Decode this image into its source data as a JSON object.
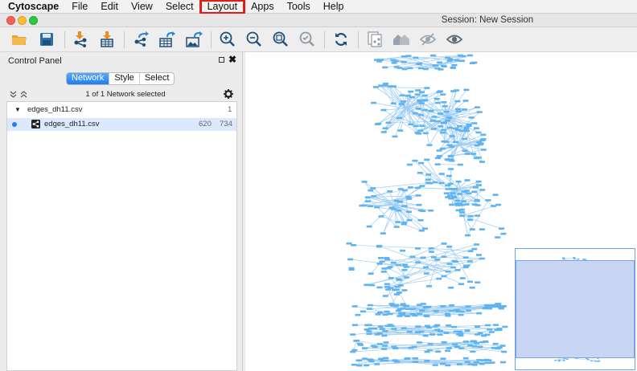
{
  "menubar": {
    "app_name": "Cytoscape",
    "items": [
      "File",
      "Edit",
      "View",
      "Select",
      "Layout",
      "Apps",
      "Tools",
      "Help"
    ],
    "highlighted": "Layout"
  },
  "window": {
    "title": "Session: New Session"
  },
  "toolbar": {
    "buttons": [
      "open-session-icon",
      "save-session-icon",
      "import-network-icon",
      "import-table-icon",
      "export-network-icon",
      "export-table-icon",
      "export-image-icon",
      "zoom-in-icon",
      "zoom-out-icon",
      "zoom-fit-icon",
      "zoom-selected-icon",
      "refresh-icon",
      "new-network-from-selection-icon",
      "home-icon",
      "hide-icon",
      "show-icon"
    ]
  },
  "control_panel": {
    "title": "Control Panel",
    "tabs": [
      "Network",
      "Style",
      "Select"
    ],
    "active_tab": "Network",
    "selection_text": "1 of 1 Network selected",
    "collection": {
      "name": "edges_dh11.csv",
      "count": "1"
    },
    "network": {
      "name": "edges_dh11.csv",
      "nodes": "620",
      "edges": "734"
    }
  },
  "colors": {
    "node": "#5fb3f0",
    "edge": "#9fcdf2",
    "highlight": "#e21b1b",
    "navigator_view": "#c8d6f4"
  }
}
